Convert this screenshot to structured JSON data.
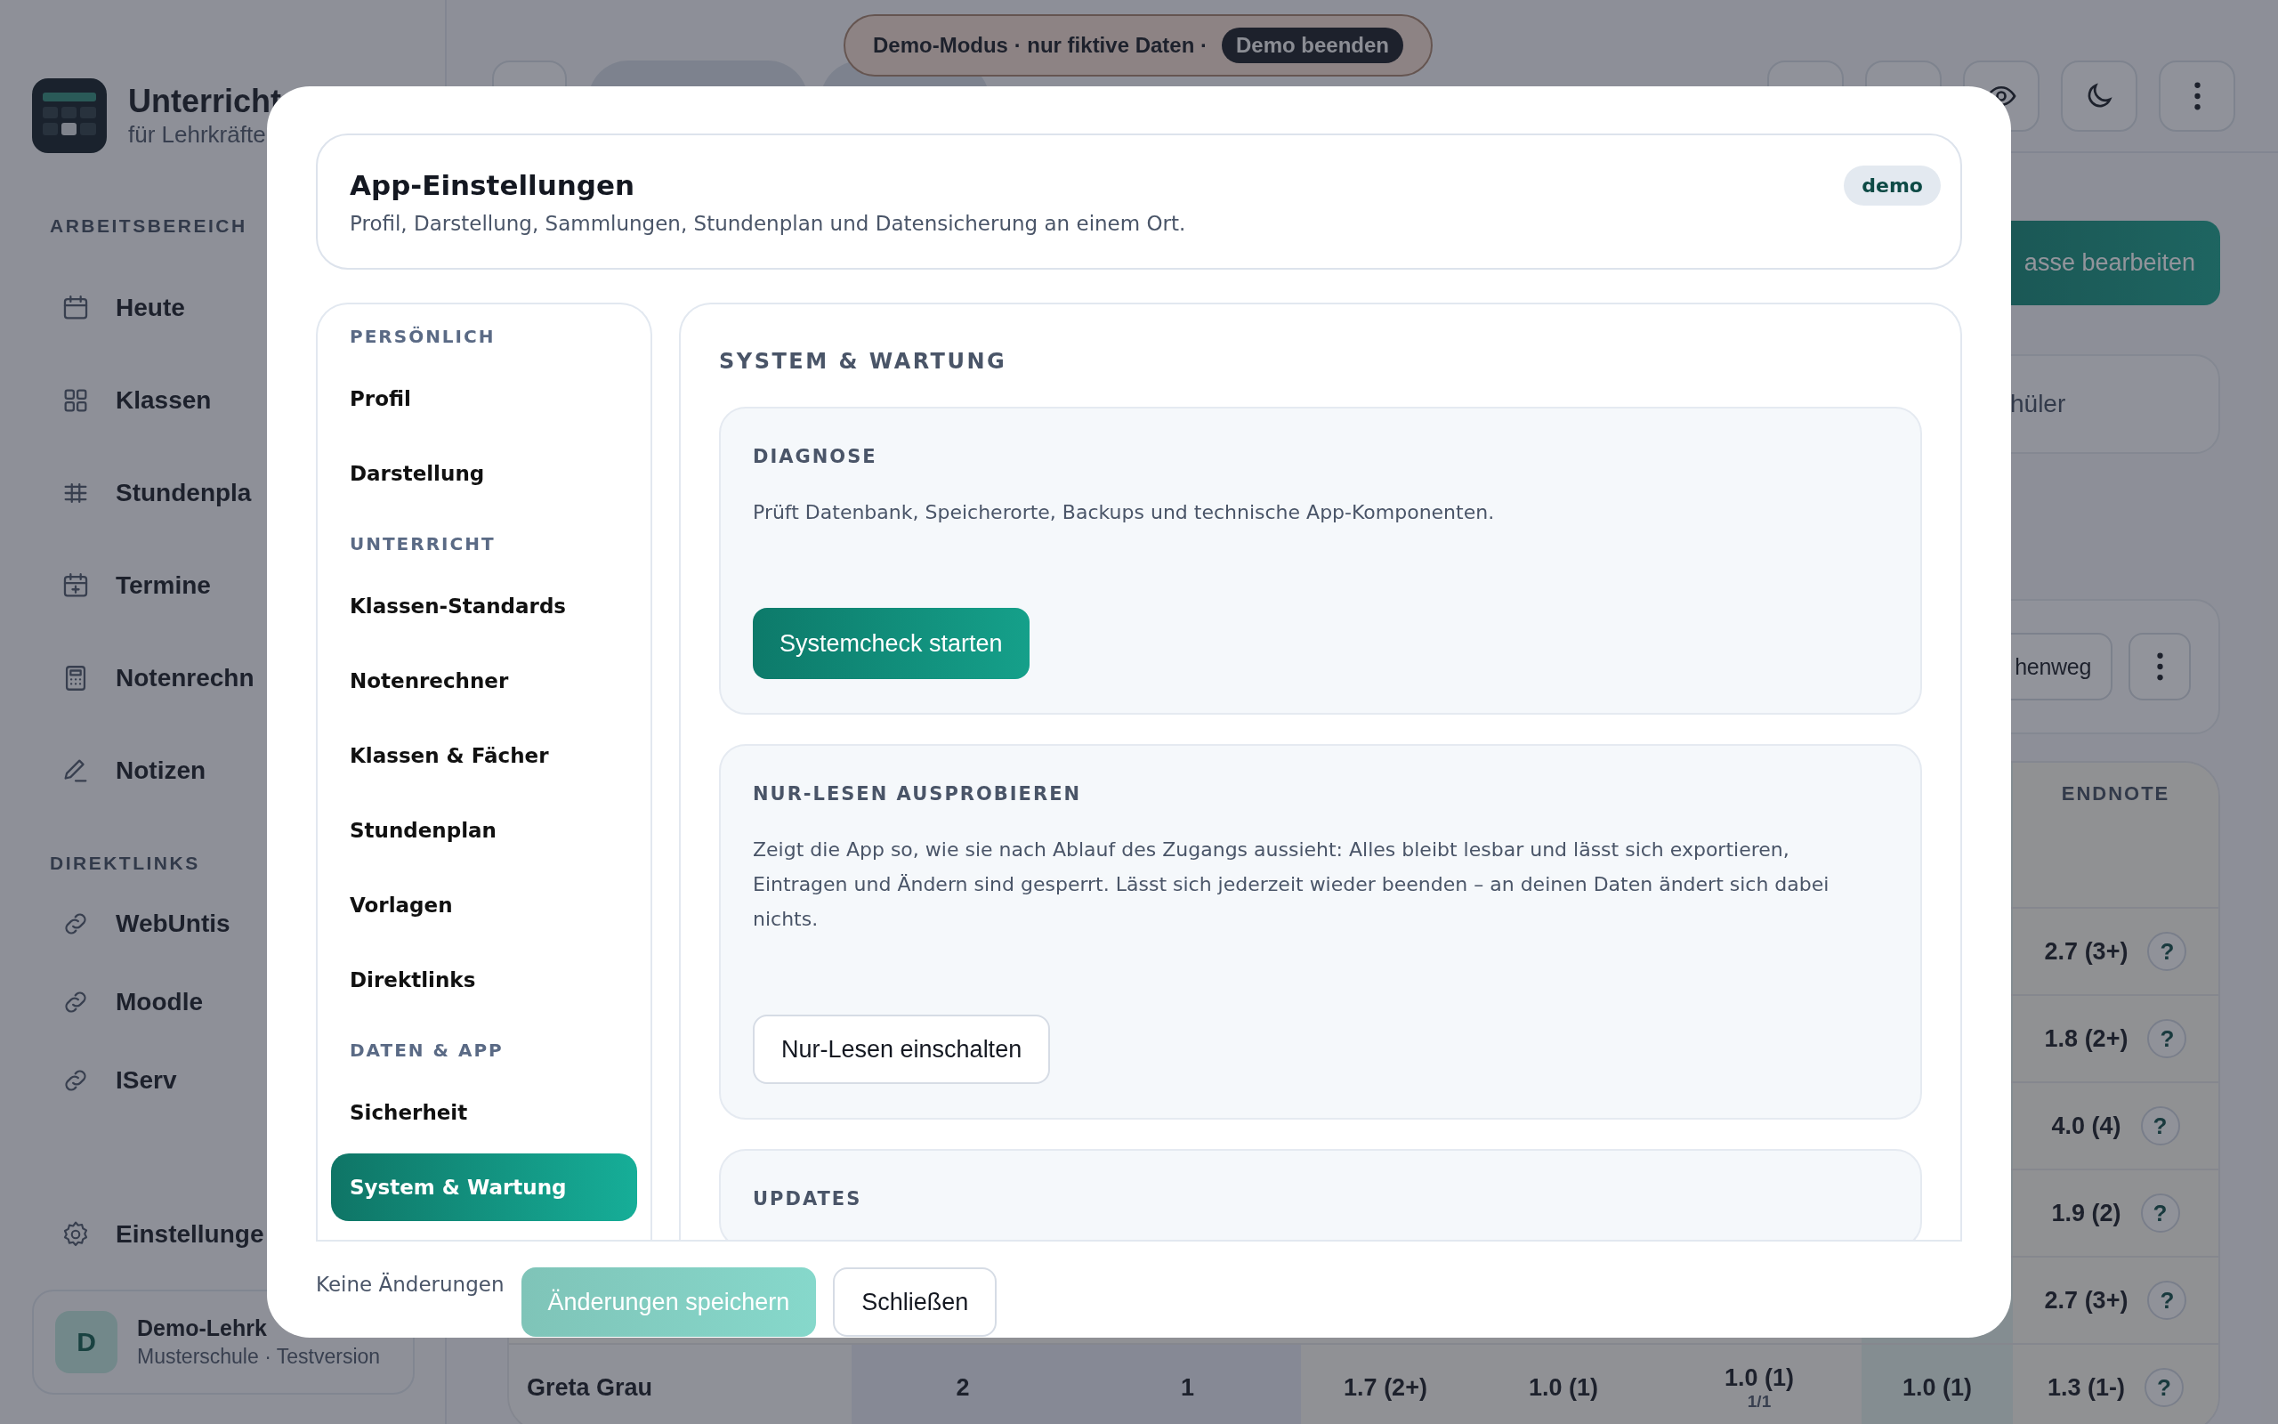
{
  "sidebar": {
    "brand": {
      "title": "Unterricht",
      "subtitle": "für Lehrkräfte"
    },
    "sections": [
      {
        "heading": "ARBEITSBEREICH",
        "items": [
          {
            "label": "Heute"
          },
          {
            "label": "Klassen"
          },
          {
            "label": "Stundenpla"
          },
          {
            "label": "Termine"
          },
          {
            "label": "Notenrechn"
          },
          {
            "label": "Notizen"
          }
        ]
      },
      {
        "heading": "DIREKTLINKS",
        "items": [
          {
            "label": "WebUntis"
          },
          {
            "label": "Moodle"
          },
          {
            "label": "IServ"
          }
        ]
      }
    ],
    "settings": "Einstellunge",
    "user": {
      "initial": "D",
      "name": "Demo-Lehrk",
      "subtitle": "Musterschule · Testversion"
    }
  },
  "demo_banner": {
    "text": "Demo-Modus · nur fiktive Daten ·",
    "button": "Demo beenden"
  },
  "main": {
    "primary_button": "asse bearbeiten",
    "stat_card": "hüler",
    "action_button": "henweg",
    "table": {
      "column_8": "ENDNOTE",
      "rows": [
        {
          "endnote": "2.7 (3+)",
          "help": "?"
        },
        {
          "endnote": "1.8 (2+)",
          "help": "?"
        },
        {
          "endnote": "4.0 (4)",
          "help": "?"
        },
        {
          "endnote": "1.9 (2)",
          "help": "?"
        },
        {
          "endnote": "2.7 (3+)",
          "help": "?"
        },
        {
          "name": "Greta Grau",
          "column_2": "2",
          "column_3": "1",
          "column_4": "1.7 (2+)",
          "column_5": "1.0 (1)",
          "column_6": "1.0 (1)",
          "column_6_sub": "1/1",
          "column_7": "1.0 (1)",
          "endnote": "1.3 (1-)",
          "help": "?"
        }
      ]
    }
  },
  "dialog": {
    "title": "App-Einstellungen",
    "subtitle": "Profil, Darstellung, Sammlungen, Stundenplan und Datensicherung an einem Ort.",
    "badge": "demo",
    "nav": [
      {
        "heading": "PERSÖNLICH",
        "items": [
          {
            "label": "Profil",
            "selected": false
          },
          {
            "label": "Darstellung",
            "selected": false
          }
        ]
      },
      {
        "heading": "UNTERRICHT",
        "items": [
          {
            "label": "Klassen-Standards",
            "selected": false
          },
          {
            "label": "Notenrechner",
            "selected": false
          },
          {
            "label": "Klassen & Fächer",
            "selected": false
          },
          {
            "label": "Stundenplan",
            "selected": false
          },
          {
            "label": "Vorlagen",
            "selected": false
          },
          {
            "label": "Direktlinks",
            "selected": false
          }
        ]
      },
      {
        "heading": "DATEN & APP",
        "items": [
          {
            "label": "Sicherheit",
            "selected": false
          },
          {
            "label": "System & Wartung",
            "selected": true
          }
        ]
      }
    ],
    "section_title": "SYSTEM & WARTUNG",
    "panels": [
      {
        "heading": "DIAGNOSE",
        "text": "Prüft Datenbank, Speicherorte, Backups und technische App-Komponenten.",
        "button": {
          "label": "Systemcheck starten",
          "kind": "primary"
        }
      },
      {
        "heading": "NUR-LESEN AUSPROBIEREN",
        "text": "Zeigt die App so, wie sie nach Ablauf des Zugangs aussieht: Alles bleibt lesbar und lässt sich exportieren, Eintragen und Ändern sind gesperrt. Lässt sich jederzeit wieder beenden – an deinen Daten ändert sich dabei nichts.",
        "button": {
          "label": "Nur-Lesen einschalten",
          "kind": "secondary"
        }
      },
      {
        "heading": "UPDATES"
      }
    ],
    "footer": {
      "status": "Keine Änderungen",
      "save": {
        "label": "Änderungen speichern",
        "disabled": true
      },
      "close": "Schließen"
    }
  }
}
